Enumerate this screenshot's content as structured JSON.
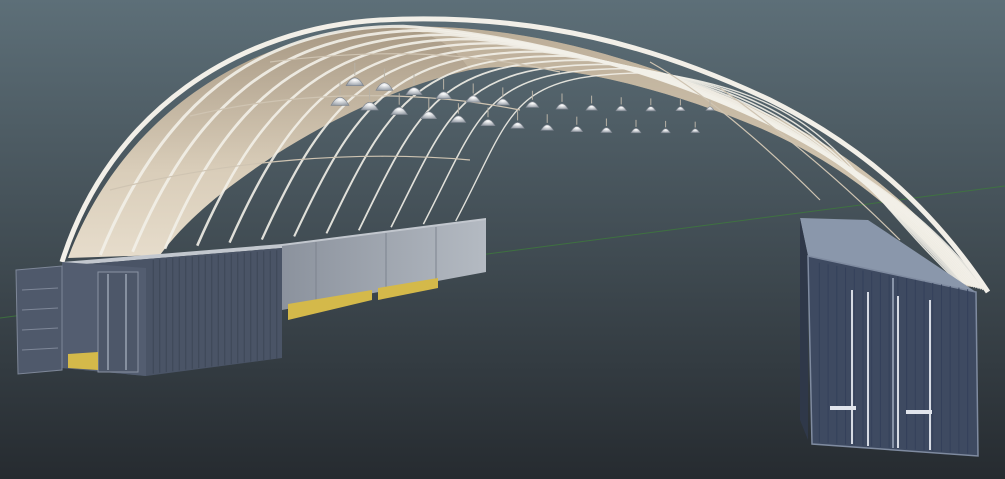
{
  "viewport": {
    "background_top": "#5d6f78",
    "background_bottom": "#262b30"
  },
  "scene": {
    "ground_axis_line_color": "#3e7a3c",
    "arch": {
      "canvas_color": "#e3d6c2",
      "canvas_shadow_color": "#a89984",
      "rib_color": "#f2efe8",
      "rib_count": 12,
      "light_count": 26
    },
    "left_container": {
      "body_color": "#4a5466",
      "side_panel_color": "#9ea5af",
      "door_open": true,
      "floor_color": "#d4b94a"
    },
    "right_container": {
      "body_color": "#3e4a61",
      "top_color": "#8a97ab",
      "door_open": false
    }
  }
}
